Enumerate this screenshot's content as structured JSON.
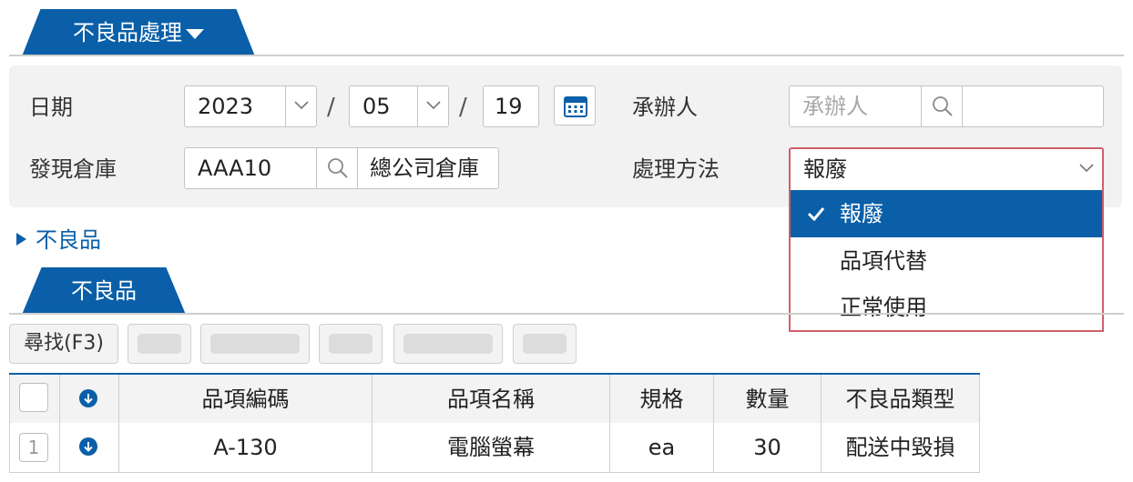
{
  "header": {
    "tab_label": "不良品處理"
  },
  "form": {
    "date_label": "日期",
    "year": "2023",
    "month": "05",
    "day": "19",
    "separator": "/",
    "handler_label": "承辦人",
    "handler_placeholder": "承辦人",
    "warehouse_label": "發現倉庫",
    "warehouse_code": "AAA10",
    "warehouse_name": "總公司倉庫",
    "method_label": "處理方法",
    "method_value": "報廢"
  },
  "method_dropdown": {
    "options": [
      "報廢",
      "品項代替",
      "正常使用"
    ],
    "selected_index": 0
  },
  "section_toggle": {
    "label": "不良品"
  },
  "subtab": {
    "label": "不良品"
  },
  "toolbar": {
    "find_label": "尋找(F3)"
  },
  "table": {
    "headers": [
      "品項編碼",
      "品項名稱",
      "規格",
      "數量",
      "不良品類型"
    ],
    "rows": [
      {
        "num": "1",
        "code": "A-130",
        "name": "電腦螢幕",
        "spec": "ea",
        "qty": "30",
        "type": "配送中毀損"
      }
    ]
  },
  "colors": {
    "accent": "#0a5fa8",
    "highlight_border": "#cf5f6c"
  }
}
